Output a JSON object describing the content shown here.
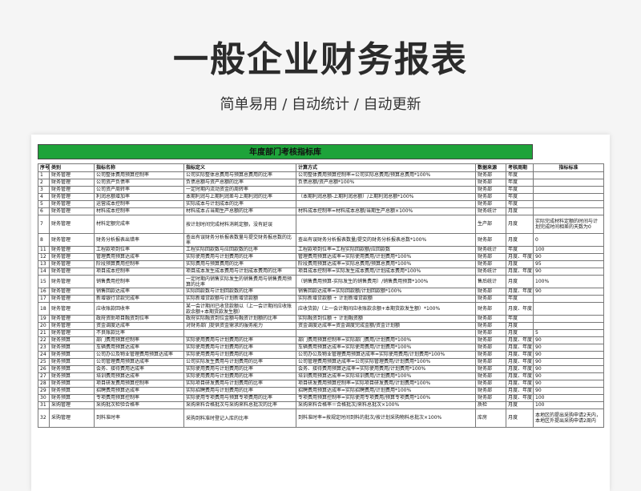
{
  "page": {
    "title": "一般企业财务报表",
    "subtitle": "简单易用 / 自动统计 / 自动更新"
  },
  "sheet": {
    "banner": "年度部门考核指标库",
    "headers": [
      "序号",
      "类别",
      "指标名称",
      "指标定义",
      "计算方式",
      "数据来源",
      "考核周期",
      "指标标准"
    ],
    "rows": [
      [
        "1",
        "财务管理",
        "公司整体费用预算控制率",
        "公司实际整体总费用与预算总费用的比率",
        "公司整体费用预算控制率=公司实际总费用/预算总费用*100%",
        "财务部",
        "年度",
        ""
      ],
      [
        "2",
        "财务管理",
        "公司资产负债率",
        "负债总额与资产总额的比率",
        "负债总额/资产总额*100%",
        "财务部",
        "年度",
        ""
      ],
      [
        "3",
        "财务管理",
        "公司资产周转率",
        "一定时期内流动资金的周转率",
        "",
        "财务部",
        "年度",
        ""
      ],
      [
        "4",
        "财务管理",
        "利润总额增加率",
        "本期利润与上期利润差与上期利润的比率",
        "（本期利润总额-上期利润总额）/上期利润总额*100%",
        "财务部",
        "年度",
        ""
      ],
      [
        "5",
        "财务管理",
        "运营成本控制率",
        "实际成本与计划成本的比率",
        "",
        "财务部",
        "年度",
        ""
      ],
      [
        "6",
        "财务管理",
        "材料成本控制率",
        "材料成本占当期生产总额的比率",
        "材料成本控制率=材料成本总额/当期生产总额×100%",
        "财务统计",
        "月度",
        ""
      ],
      [
        "7",
        "财务管理",
        "材料定额完成率",
        "按计划时间完成材料消耗定额，没有延误",
        "",
        "生产部",
        "月度",
        "实际完成材料定额的时间与计划完成时间相差的天数为0"
      ],
      [
        "8",
        "财务管理",
        "财务分析报表出错率",
        "查出有误财务分析报表数量与提交财务报总数的比率",
        "查出有误财务分析报表数量/提交的财务分析报表总数*100%",
        "财务部",
        "月度",
        "0"
      ],
      [
        "11",
        "财务管理",
        "工程款项到位率",
        "工程实际回款数与应回款数的比率",
        "工程款项到位率=工程实际回款额/应回款数",
        "财务统计",
        "年度",
        "100"
      ],
      [
        "12",
        "财务管理",
        "管理费用预算达成率",
        "实际使用费用与计划费用的比率",
        "管理费用预算达成率=实际使用费用/计划费用*100%",
        "财务部",
        "月度、年度",
        "90"
      ],
      [
        "13",
        "财务管理",
        "阶段预算费用控制率",
        "实际费用与预算费用的比率",
        "阶段费用预算达成率=实际总费用/预算总费用*100%",
        "财务部",
        "月度",
        "95"
      ],
      [
        "14",
        "财务管理",
        "项目成本控制率",
        "项目成本发生成本费用与计划成本费用的比率",
        "项目成本控制率=实际发生成本费用/计划成本费用*100%",
        "财务统计",
        "月度、年度",
        "90"
      ],
      [
        "15",
        "财务管理",
        "销售费用控制率",
        "一定时期内销售实际发生的销售费用与销售费用预算的比率",
        "（销售费用预算-实际发生的销售费用）/销售费用预算*100%",
        "售后统计",
        "月度",
        "100%"
      ],
      [
        "16",
        "财务管理",
        "销售回款达成率",
        "实际回款数与计划回款数的比率",
        "销售回款达成率=实际回款额/计划回款额*100%",
        "财务部",
        "月度、年度",
        "90"
      ],
      [
        "17",
        "财务管理",
        "新增银行贷款完成率",
        "实际新增贷款额与计划新增贷款额",
        "实际新增贷款额 ÷ 计划新增贷款额",
        "财务部",
        "年度",
        ""
      ],
      [
        "18",
        "财务管理",
        "应收账款回收率",
        "某一会计期间已收货款额以（上一会计期间应收账款余额+本期货款发生额）",
        "应收货款/（上一会计期间应收账款余额+本期货款发生额）*100%",
        "财务部",
        "月度、年度",
        ""
      ],
      [
        "19",
        "财务管理",
        "政府资助项目融资到位率",
        "政府实际融资到位金额与融资计划额的比率",
        "实际融资到位额 ÷ 计划融资额",
        "财务部",
        "年度",
        ""
      ],
      [
        "20",
        "财务管理",
        "资金调度达成率",
        "对财务部门提供资金需求的服务能力",
        "资金调度达成率=资金调度完成金额/资金计划额",
        "财务部",
        "月度",
        ""
      ],
      [
        "21",
        "财务管理",
        "不良账款比率",
        "",
        "",
        "财务部",
        "月度",
        "5"
      ],
      [
        "22",
        "财务预算",
        "部门费用预算控制率",
        "实际使用费用与计划费用的比率",
        "部门费用预算控制率=实际部门费用/计划费用*100%",
        "财务部",
        "月度、年度",
        "90"
      ],
      [
        "23",
        "财务预算",
        "车辆费用预算达成率",
        "实际使用费用与计划费用的比率",
        "车辆费用预算达成率=实际使用费用/计划费用*100%",
        "财务部",
        "月度、年度",
        "90"
      ],
      [
        "24",
        "财务预算",
        "公司办公及物业管理费用预算达成率",
        "实际使用费用与计划费用的比率",
        "公司办公及物业管理费用预算达成率=实际使用费用/计划费用*100%",
        "财务部",
        "月度、年度",
        "90"
      ],
      [
        "25",
        "财务预算",
        "公司管理费用预算达成率",
        "公司实际发生费用与计划费用的比率",
        "公司管理费用预算达成率=公司实际管理费用/计划费用*100%",
        "财务部",
        "月度、年度",
        "90"
      ],
      [
        "26",
        "财务预算",
        "会务、接待费用达成率",
        "实际使用费用与计划费用的比率",
        "会务、接待费用预算达成率=实际使用费用/计划费用*100%",
        "财务部",
        "月度、年度",
        "90"
      ],
      [
        "27",
        "财务预算",
        "培训费用预算达成率",
        "实际使用费用与计划费用的比率",
        "培训费用预算达成率=实际培训费用/计划费用*100%",
        "财务部",
        "月度、年度",
        "90"
      ],
      [
        "28",
        "财务预算",
        "项目研发费用预算控制率",
        "实际项目研发费用与计划费用的比率",
        "项目研发费用预算控制率=实际项目研发费用/计划费用*100%",
        "财务部",
        "月度、年度",
        "90"
      ],
      [
        "29",
        "财务预算",
        "招聘费用预算达成率",
        "实际招聘费用与计划费用的比率",
        "招聘费用预算达成率=实际招聘费用/计划费用*100%",
        "财务部",
        "月度、年度",
        "90"
      ],
      [
        "30",
        "财务预算",
        "专项费用预算控制率",
        "实际使用专项费用与预算专项费用的比率",
        "专项费用预算控制率=实际使用专项费用/预算专项费用*100%",
        "财务部",
        "月度、年度",
        "100"
      ],
      [
        "31",
        "采购管理",
        "采购批次检验合格率",
        "采购来料合格批次与采购来料总批次的比率",
        "采购来料合格率＝合格批次/来料总批次×100%",
        "质检",
        "月度",
        "100"
      ],
      [
        "32",
        "采购管理",
        "到料准时率",
        "采购到料准时登记入库的比率",
        "到料准时率=按规定时间到料的批次/按计划采购物料总批次×100%",
        "库房",
        "月度",
        "本地区的提出采购申请2天内，本地区外提出采购申请2周内"
      ]
    ]
  }
}
